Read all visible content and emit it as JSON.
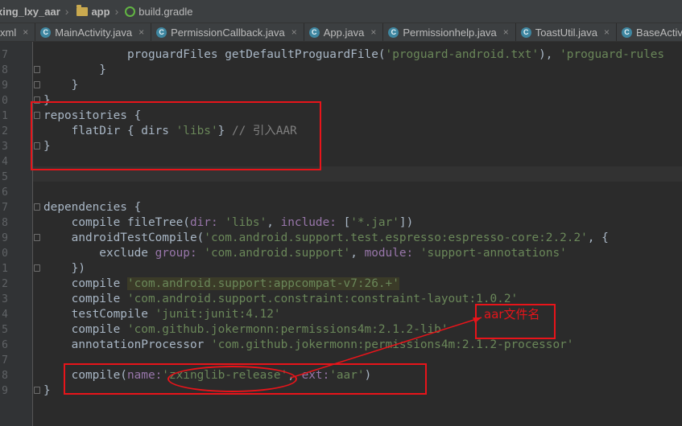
{
  "breadcrumb": {
    "project": "xing_lxy_aar",
    "module": "app",
    "file": "build.gradle"
  },
  "tabs": [
    {
      "label": "xml",
      "icon": ""
    },
    {
      "label": "MainActivity.java",
      "icon": "class-icon"
    },
    {
      "label": "PermissionCallback.java",
      "icon": "class-icon"
    },
    {
      "label": "App.java",
      "icon": "class-icon"
    },
    {
      "label": "Permissionhelp.java",
      "icon": "class-icon"
    },
    {
      "label": "ToastUtil.java",
      "icon": "class-icon"
    },
    {
      "label": "BaseActivi",
      "icon": "class-icon"
    }
  ],
  "line_numbers": [
    "7",
    "8",
    "9",
    "0",
    "1",
    "2",
    "3",
    "4",
    "5",
    "6",
    "7",
    "8",
    "9",
    "0",
    "1",
    "2",
    "3",
    "4",
    "5",
    "6",
    "7",
    "8",
    "9"
  ],
  "code": {
    "l0_a": "            proguardFiles getDefaultProguardFile(",
    "l0_b": "'proguard-android.txt'",
    "l0_c": "), ",
    "l0_d": "'proguard-rules",
    "l1": "        }",
    "l2": "    }",
    "l3": "}",
    "l4": "repositories {",
    "l5_a": "    flatDir { dirs ",
    "l5_b": "'libs'",
    "l5_c": "} ",
    "l5_d": "// 引入AAR",
    "l6": "}",
    "l9": "dependencies {",
    "l10_a": "    compile fileTree(",
    "l10_b": "dir: ",
    "l10_c": "'libs'",
    "l10_d": ", ",
    "l10_e": "include: ",
    "l10_f": "[",
    "l10_g": "'*.jar'",
    "l10_h": "])",
    "l11_a": "    androidTestCompile(",
    "l11_b": "'com.android.support.test.espresso:espresso-core:2.2.2'",
    "l11_c": ", {",
    "l12_a": "        exclude ",
    "l12_b": "group: ",
    "l12_c": "'com.android.support'",
    "l12_d": ", ",
    "l12_e": "module: ",
    "l12_f": "'support-annotations'",
    "l13": "    })",
    "l14_a": "    compile ",
    "l14_b": "'com.android.support:appcompat-v7:26.+'",
    "l15_a": "    compile ",
    "l15_b": "'com.android.support.constraint:constraint-layout:1.0.2'",
    "l16_a": "    testCompile ",
    "l16_b": "'junit:junit:4.12'",
    "l17_a": "    compile ",
    "l17_b": "'com.github.jokermonn:permissions4m:2.1.2-lib'",
    "l18_a": "    annotationProcessor ",
    "l18_b": "'com.github.jokermonn:permissions4m:2.1.2-processor'",
    "l20_a": "    compile(",
    "l20_b": "name:",
    "l20_c": "'zxinglib-release'",
    "l20_d": ", ",
    "l20_e": "ext:",
    "l20_f": "'aar'",
    "l20_g": ")",
    "l21": "}"
  },
  "annotation": {
    "label": "aar文件名"
  },
  "colors": {
    "keyword": "#cc7832",
    "string": "#6a8759",
    "named_arg": "#9876aa",
    "comment": "#808080",
    "annotation": "#e8141a"
  }
}
